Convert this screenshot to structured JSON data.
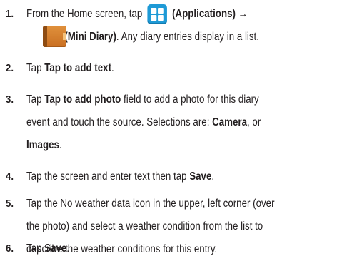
{
  "steps": [
    {
      "number": "1.",
      "line1_pre": "From the Home screen, tap",
      "line1_apps_label": "(Applications)",
      "line1_arrow": "→",
      "line2_diary_label": "(Mini Diary)",
      "line2_rest": ". Any diary entries display in a list.",
      "apps_icon": "applications-grid-icon",
      "diary_icon": "mini-diary-book-icon"
    },
    {
      "number": "2.",
      "pre": "Tap",
      "bold": "Tap to add text",
      "post": "."
    },
    {
      "number": "3.",
      "line1_pre": "Tap",
      "line1_bold": "Tap to add photo",
      "line1_post": "field to add a photo for this diary",
      "line2": "event and touch the source. Selections are:",
      "line2_bold": "Camera",
      "line2_post": ", or",
      "line3_bold": "Images",
      "line3_post": "."
    },
    {
      "number": "4.",
      "pre": "Tap the screen and enter text then tap",
      "bold": "Save",
      "post": "."
    },
    {
      "number": "5.",
      "line1": "Tap the No weather data icon in the upper, left corner (over",
      "line2": "the photo) and select a weather condition from the list to",
      "line3": "describe the weather conditions for this entry."
    },
    {
      "number": "6.",
      "pre": "Tap",
      "bold": "Save",
      "post": "."
    }
  ],
  "colors": {
    "text": "#231f20",
    "apps_icon": "#1e9ad6",
    "diary_icon": "#d9822e"
  }
}
